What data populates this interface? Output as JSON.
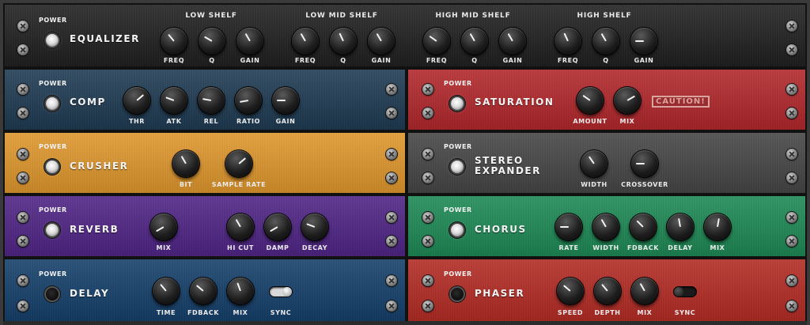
{
  "power_label": "POWER",
  "equalizer": {
    "title": "EQUALIZER",
    "power": "on",
    "sections": [
      "LOW SHELF",
      "LOW MID SHELF",
      "HIGH MID SHELF",
      "HIGH SHELF"
    ],
    "knob_labels": [
      "FREQ",
      "Q",
      "GAIN"
    ]
  },
  "comp": {
    "title": "COMP",
    "power": "on",
    "knobs": [
      "THR",
      "ATK",
      "REL",
      "RATIO",
      "GAIN"
    ]
  },
  "saturation": {
    "title": "SATURATION",
    "power": "on",
    "knobs": [
      "AMOUNT",
      "MIX"
    ],
    "warning": "CAUTION!"
  },
  "crusher": {
    "title": "CRUSHER",
    "power": "on",
    "knobs": [
      "BIT",
      "SAMPLE RATE"
    ]
  },
  "stereo_expander": {
    "title_line1": "STEREO",
    "title_line2": "EXPANDER",
    "power": "on",
    "knobs": [
      "WIDTH",
      "CROSSOVER"
    ]
  },
  "reverb": {
    "title": "REVERB",
    "power": "on",
    "knobs": [
      "MIX",
      "HI CUT",
      "DAMP",
      "DECAY"
    ]
  },
  "chorus": {
    "title": "CHORUS",
    "power": "on",
    "knobs": [
      "RATE",
      "WIDTH",
      "FDBACK",
      "DELAY",
      "MIX"
    ]
  },
  "delay": {
    "title": "DELAY",
    "power": "off",
    "knobs": [
      "TIME",
      "FDBACK",
      "MIX"
    ],
    "sync_label": "SYNC",
    "sync_state": "on"
  },
  "phaser": {
    "title": "PHASER",
    "power": "off",
    "knobs": [
      "SPEED",
      "DEPTH",
      "MIX"
    ],
    "sync_label": "SYNC",
    "sync_state": "off"
  },
  "colors": {
    "equalizer": "#1f1f1f",
    "comp": "#1d3a52",
    "saturation": "#b3262a",
    "crusher": "#e2982c",
    "stereo_expander": "#454545",
    "reverb": "#4f2386",
    "chorus": "#1c8a55",
    "delay": "#143f6b",
    "phaser": "#b52a23"
  }
}
